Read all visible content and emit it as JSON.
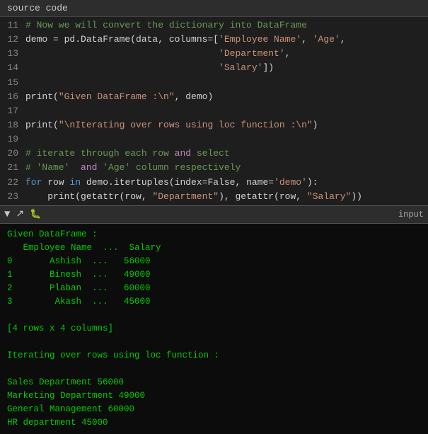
{
  "topbar": {
    "label": "source code"
  },
  "lines": [
    {
      "num": "11",
      "tokens": [
        {
          "t": "# Now we will convert the dictionary into DataFrame",
          "c": "kw-comment"
        }
      ]
    },
    {
      "num": "12",
      "tokens": [
        {
          "t": "demo = pd.DataFrame(data, columns=[",
          "c": "plain"
        },
        {
          "t": "'Employee Name'",
          "c": "kw-string"
        },
        {
          "t": ", ",
          "c": "plain"
        },
        {
          "t": "'Age'",
          "c": "kw-string"
        },
        {
          "t": ",",
          "c": "plain"
        }
      ]
    },
    {
      "num": "13",
      "tokens": [
        {
          "t": "                                   ",
          "c": "plain"
        },
        {
          "t": "'Department'",
          "c": "kw-string"
        },
        {
          "t": ",",
          "c": "plain"
        }
      ]
    },
    {
      "num": "14",
      "tokens": [
        {
          "t": "                                   ",
          "c": "plain"
        },
        {
          "t": "'Salary'",
          "c": "kw-string"
        },
        {
          "t": "])",
          "c": "plain"
        }
      ]
    },
    {
      "num": "15",
      "tokens": []
    },
    {
      "num": "16",
      "tokens": [
        {
          "t": "print(",
          "c": "plain"
        },
        {
          "t": "\"Given DataFrame :\\n\"",
          "c": "kw-string"
        },
        {
          "t": ", demo)",
          "c": "plain"
        }
      ]
    },
    {
      "num": "17",
      "tokens": []
    },
    {
      "num": "18",
      "tokens": [
        {
          "t": "print(",
          "c": "plain"
        },
        {
          "t": "\"\\nIterating over rows using loc function :\\n\"",
          "c": "kw-string"
        },
        {
          "t": ")",
          "c": "plain"
        }
      ]
    },
    {
      "num": "19",
      "tokens": []
    },
    {
      "num": "20",
      "tokens": [
        {
          "t": "# iterate through each row ",
          "c": "kw-comment"
        },
        {
          "t": "and",
          "c": "kw-and"
        },
        {
          "t": " select",
          "c": "kw-comment"
        }
      ]
    },
    {
      "num": "21",
      "tokens": [
        {
          "t": "# 'Name'  ",
          "c": "kw-comment"
        },
        {
          "t": "and",
          "c": "kw-and"
        },
        {
          "t": " 'Age' column respectively",
          "c": "kw-comment"
        }
      ]
    },
    {
      "num": "22",
      "tokens": [
        {
          "t": "for",
          "c": "kw-keyword"
        },
        {
          "t": " row ",
          "c": "plain"
        },
        {
          "t": "in",
          "c": "kw-keyword"
        },
        {
          "t": " demo.itertuples(index=False, name=",
          "c": "plain"
        },
        {
          "t": "'demo'",
          "c": "kw-string"
        },
        {
          "t": "):",
          "c": "plain"
        }
      ]
    },
    {
      "num": "23",
      "tokens": [
        {
          "t": "    print(getattr(row, ",
          "c": "plain"
        },
        {
          "t": "\"Department\"",
          "c": "kw-string"
        },
        {
          "t": "), getattr(row, ",
          "c": "plain"
        },
        {
          "t": "\"Salary\"",
          "c": "kw-string"
        },
        {
          "t": "))",
          "c": "plain"
        }
      ]
    }
  ],
  "toolbar": {
    "icons": [
      "▼",
      "↗",
      "🐛"
    ],
    "label": "input"
  },
  "output": [
    "Given DataFrame :",
    "   Employee Name  ...  Salary",
    "0       Ashish  ...   56000",
    "1       Binesh  ...   49000",
    "2       Plaban  ...   60000",
    "3        Akash  ...   45000",
    "",
    "[4 rows x 4 columns]",
    "",
    "Iterating over rows using loc function :",
    "",
    "Sales Department 56000",
    "Marketing Department 49000",
    "General Management 60000",
    "HR department 45000"
  ]
}
